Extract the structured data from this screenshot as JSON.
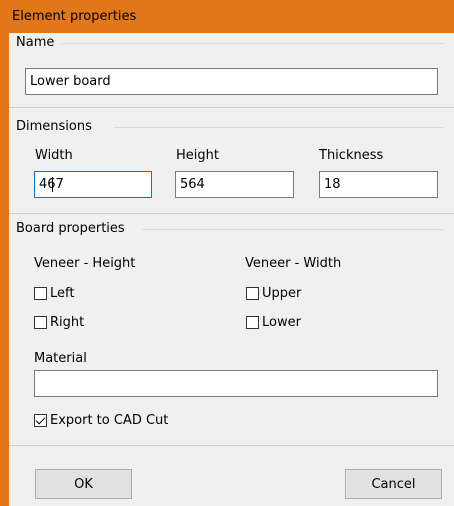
{
  "window": {
    "title": "Element properties",
    "accent_color": "#e2761b"
  },
  "name_group": {
    "label": "Name",
    "value": "Lower board"
  },
  "dimensions": {
    "label": "Dimensions",
    "width_label": "Width",
    "width_value": "467",
    "height_label": "Height",
    "height_value": "564",
    "thickness_label": "Thickness",
    "thickness_value": "18"
  },
  "board_properties": {
    "label": "Board properties",
    "veneer_height_label": "Veneer - Height",
    "veneer_width_label": "Veneer - Width",
    "left_label": "Left",
    "left_checked": false,
    "right_label": "Right",
    "right_checked": false,
    "upper_label": "Upper",
    "upper_checked": false,
    "lower_label": "Lower",
    "lower_checked": false,
    "material_label": "Material",
    "material_value": "",
    "export_label": "Export to CAD Cut",
    "export_checked": true
  },
  "buttons": {
    "ok_label": "OK",
    "cancel_label": "Cancel"
  }
}
